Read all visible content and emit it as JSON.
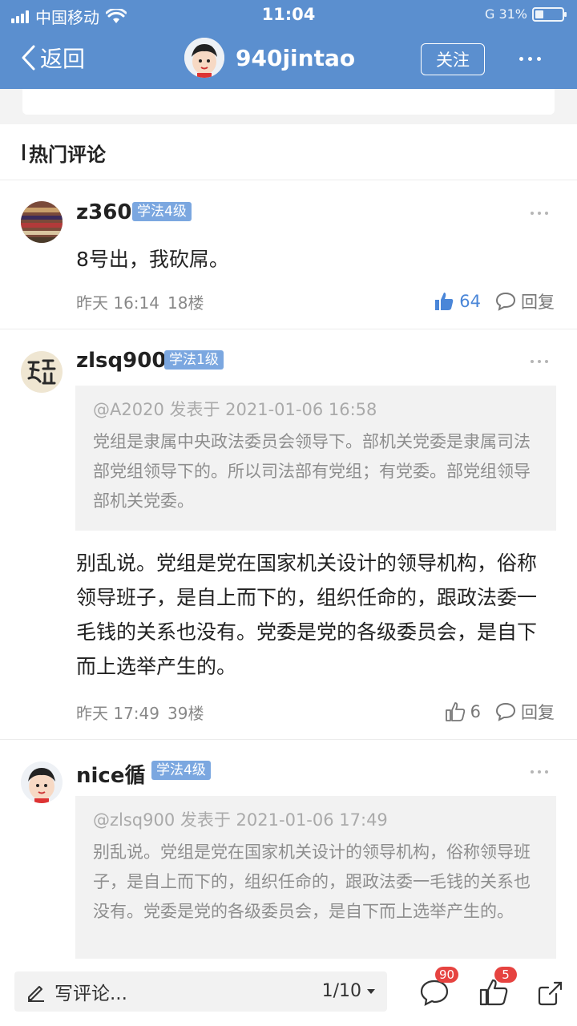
{
  "status_bar": {
    "carrier": "中国移动",
    "time": "11:04",
    "right_text": "G 31%",
    "battery_level": 0.31
  },
  "nav": {
    "back_label": "返回",
    "username": "940jintao",
    "follow_label": "关注"
  },
  "section": {
    "title": "热门评论"
  },
  "comments": [
    {
      "username": "z360",
      "level": "学法4级",
      "text": "8号出，我砍屌。",
      "time": "昨天 16:14",
      "floor": "18楼",
      "likes": "64",
      "reply_label": "回复",
      "liked": true
    },
    {
      "username": "zlsq900",
      "level": "学法1级",
      "quote": {
        "header": "@A2020 发表于 2021-01-06 16:58",
        "text": "党组是隶属中央政法委员会领导下。部机关党委是隶属司法部党组领导下的。所以司法部有党组；有党委。部党组领导部机关党委。"
      },
      "text": "别乱说。党组是党在国家机关设计的领导机构，俗称领导班子，是自上而下的，组织任命的，跟政法委一毛钱的关系也没有。党委是党的各级委员会，是自下而上选举产生的。",
      "time": "昨天 17:49",
      "floor": "39楼",
      "likes": "6",
      "reply_label": "回复",
      "liked": false
    },
    {
      "username": "nice循",
      "level": "学法4级",
      "quote": {
        "header": "@zlsq900 发表于 2021-01-06 17:49",
        "text": "别乱说。党组是党在国家机关设计的领导机构，俗称领导班子，是自上而下的，组织任命的，跟政法委一毛钱的关系也没有。党委是党的各级委员会，是自下而上选举产生的。"
      }
    }
  ],
  "bottom_bar": {
    "compose_placeholder": "写评论...",
    "page_indicator": "1/10",
    "comment_count": "90",
    "like_count": "5"
  },
  "colors": {
    "header_bg": "#5b8fcf",
    "badge_bg": "#7ba7e0",
    "like_active": "#4a86d8",
    "notification_red": "#e64340"
  }
}
